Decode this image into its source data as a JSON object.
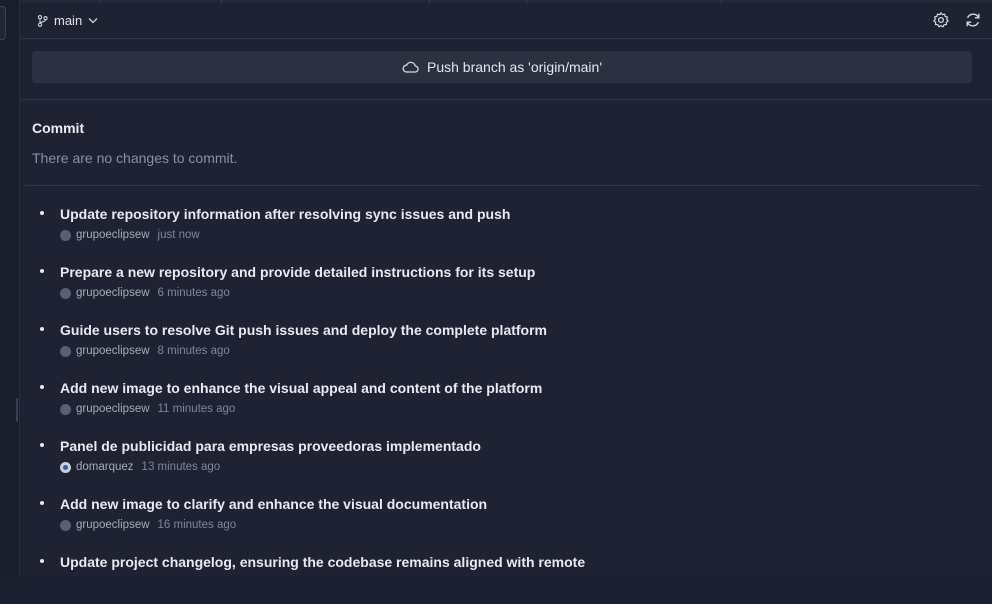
{
  "branch": {
    "name": "main",
    "icon": "git-branch-icon"
  },
  "header_icons": [
    "gear-icon",
    "refresh-icon"
  ],
  "push": {
    "label": "Push branch as 'origin/main'",
    "icon": "cloud-icon"
  },
  "commit": {
    "title": "Commit",
    "empty_text": "There are no changes to commit."
  },
  "history": [
    {
      "message": "Update repository information after resolving sync issues and push",
      "author": "grupoeclipsew",
      "time": "just now",
      "avatar": "default"
    },
    {
      "message": "Prepare a new repository and provide detailed instructions for its setup",
      "author": "grupoeclipsew",
      "time": "6 minutes ago",
      "avatar": "default"
    },
    {
      "message": "Guide users to resolve Git push issues and deploy the complete platform",
      "author": "grupoeclipsew",
      "time": "8 minutes ago",
      "avatar": "default"
    },
    {
      "message": "Add new image to enhance the visual appeal and content of the platform",
      "author": "grupoeclipsew",
      "time": "11 minutes ago",
      "avatar": "default"
    },
    {
      "message": "Panel de publicidad para empresas proveedoras implementado",
      "author": "domarquez",
      "time": "13 minutes ago",
      "avatar": "alt"
    },
    {
      "message": "Add new image to clarify and enhance the visual documentation",
      "author": "grupoeclipsew",
      "time": "16 minutes ago",
      "avatar": "default"
    },
    {
      "message": "Update project changelog, ensuring the codebase remains aligned with remote",
      "author": "",
      "time": "",
      "avatar": "default"
    }
  ]
}
